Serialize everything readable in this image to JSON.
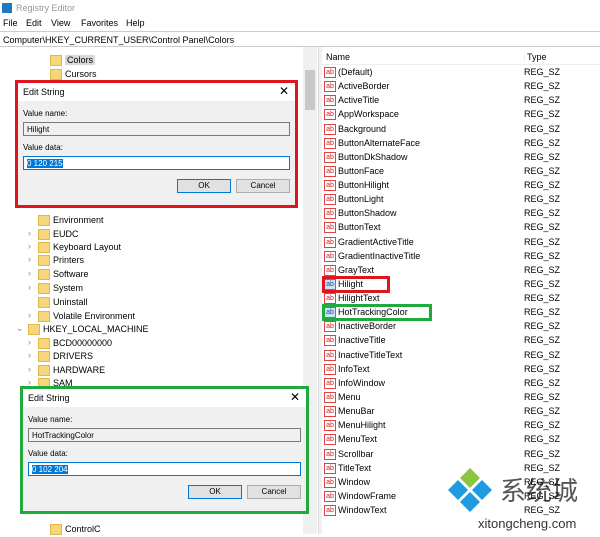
{
  "window": {
    "title": "Registry Editor"
  },
  "menu": [
    {
      "label": "File"
    },
    {
      "label": "Edit"
    },
    {
      "label": "View"
    },
    {
      "label": "Favorites"
    },
    {
      "label": "Help"
    }
  ],
  "address": "Computer\\HKEY_CURRENT_USER\\Control Panel\\Colors",
  "tree": [
    {
      "label": "Colors",
      "indent": 3,
      "selected": true
    },
    {
      "label": "Cursors",
      "indent": 3
    },
    {
      "label": "Environment",
      "indent": 2
    },
    {
      "label": "EUDC",
      "indent": 2,
      "expandable": true
    },
    {
      "label": "Keyboard Layout",
      "indent": 2,
      "expandable": true
    },
    {
      "label": "Printers",
      "indent": 2,
      "expandable": true
    },
    {
      "label": "Software",
      "indent": 2,
      "expandable": true
    },
    {
      "label": "System",
      "indent": 2,
      "expandable": true
    },
    {
      "label": "Uninstall",
      "indent": 2
    },
    {
      "label": "Volatile Environment",
      "indent": 2,
      "expandable": true
    },
    {
      "label": "HKEY_LOCAL_MACHINE",
      "indent": 1,
      "expanded": true
    },
    {
      "label": "BCD00000000",
      "indent": 2,
      "expandable": true
    },
    {
      "label": "DRIVERS",
      "indent": 2,
      "expandable": true
    },
    {
      "label": "HARDWARE",
      "indent": 2,
      "expandable": true
    },
    {
      "label": "SAM",
      "indent": 2,
      "expandable": true
    },
    {
      "label": "ControlC",
      "indent": 3
    }
  ],
  "dialogs": [
    {
      "title": "Edit String",
      "name_label": "Value name:",
      "name_value": "Hilight",
      "data_label": "Value data:",
      "data_value": "0 120 215",
      "ok": "OK",
      "cancel": "Cancel",
      "highlight_color": "#e0141e"
    },
    {
      "title": "Edit String",
      "name_label": "Value name:",
      "name_value": "HotTrackingColor",
      "data_label": "Value data:",
      "data_value": "0 102 204",
      "ok": "OK",
      "cancel": "Cancel",
      "highlight_color": "#1faa3c"
    }
  ],
  "columns": {
    "name": "Name",
    "type": "Type"
  },
  "values": [
    {
      "name": "(Default)",
      "type": "REG_SZ"
    },
    {
      "name": "ActiveBorder",
      "type": "REG_SZ"
    },
    {
      "name": "ActiveTitle",
      "type": "REG_SZ"
    },
    {
      "name": "AppWorkspace",
      "type": "REG_SZ"
    },
    {
      "name": "Background",
      "type": "REG_SZ"
    },
    {
      "name": "ButtonAlternateFace",
      "type": "REG_SZ"
    },
    {
      "name": "ButtonDkShadow",
      "type": "REG_SZ"
    },
    {
      "name": "ButtonFace",
      "type": "REG_SZ"
    },
    {
      "name": "ButtonHilight",
      "type": "REG_SZ"
    },
    {
      "name": "ButtonLight",
      "type": "REG_SZ"
    },
    {
      "name": "ButtonShadow",
      "type": "REG_SZ"
    },
    {
      "name": "ButtonText",
      "type": "REG_SZ"
    },
    {
      "name": "GradientActiveTitle",
      "type": "REG_SZ"
    },
    {
      "name": "GradientInactiveTitle",
      "type": "REG_SZ"
    },
    {
      "name": "GrayText",
      "type": "REG_SZ"
    },
    {
      "name": "Hilight",
      "type": "REG_SZ",
      "highlight": "#e0141e"
    },
    {
      "name": "HilightText",
      "type": "REG_SZ"
    },
    {
      "name": "HotTrackingColor",
      "type": "REG_SZ",
      "highlight": "#1faa3c"
    },
    {
      "name": "InactiveBorder",
      "type": "REG_SZ"
    },
    {
      "name": "InactiveTitle",
      "type": "REG_SZ"
    },
    {
      "name": "InactiveTitleText",
      "type": "REG_SZ"
    },
    {
      "name": "InfoText",
      "type": "REG_SZ"
    },
    {
      "name": "InfoWindow",
      "type": "REG_SZ"
    },
    {
      "name": "Menu",
      "type": "REG_SZ"
    },
    {
      "name": "MenuBar",
      "type": "REG_SZ"
    },
    {
      "name": "MenuHilight",
      "type": "REG_SZ"
    },
    {
      "name": "MenuText",
      "type": "REG_SZ"
    },
    {
      "name": "Scrollbar",
      "type": "REG_SZ"
    },
    {
      "name": "TitleText",
      "type": "REG_SZ"
    },
    {
      "name": "Window",
      "type": "REG_SZ"
    },
    {
      "name": "WindowFrame",
      "type": "REG_SZ"
    },
    {
      "name": "WindowText",
      "type": "REG_SZ"
    }
  ],
  "value_icon": "ab",
  "watermark": {
    "brand": "系统城",
    "url": "xitongcheng.com"
  }
}
